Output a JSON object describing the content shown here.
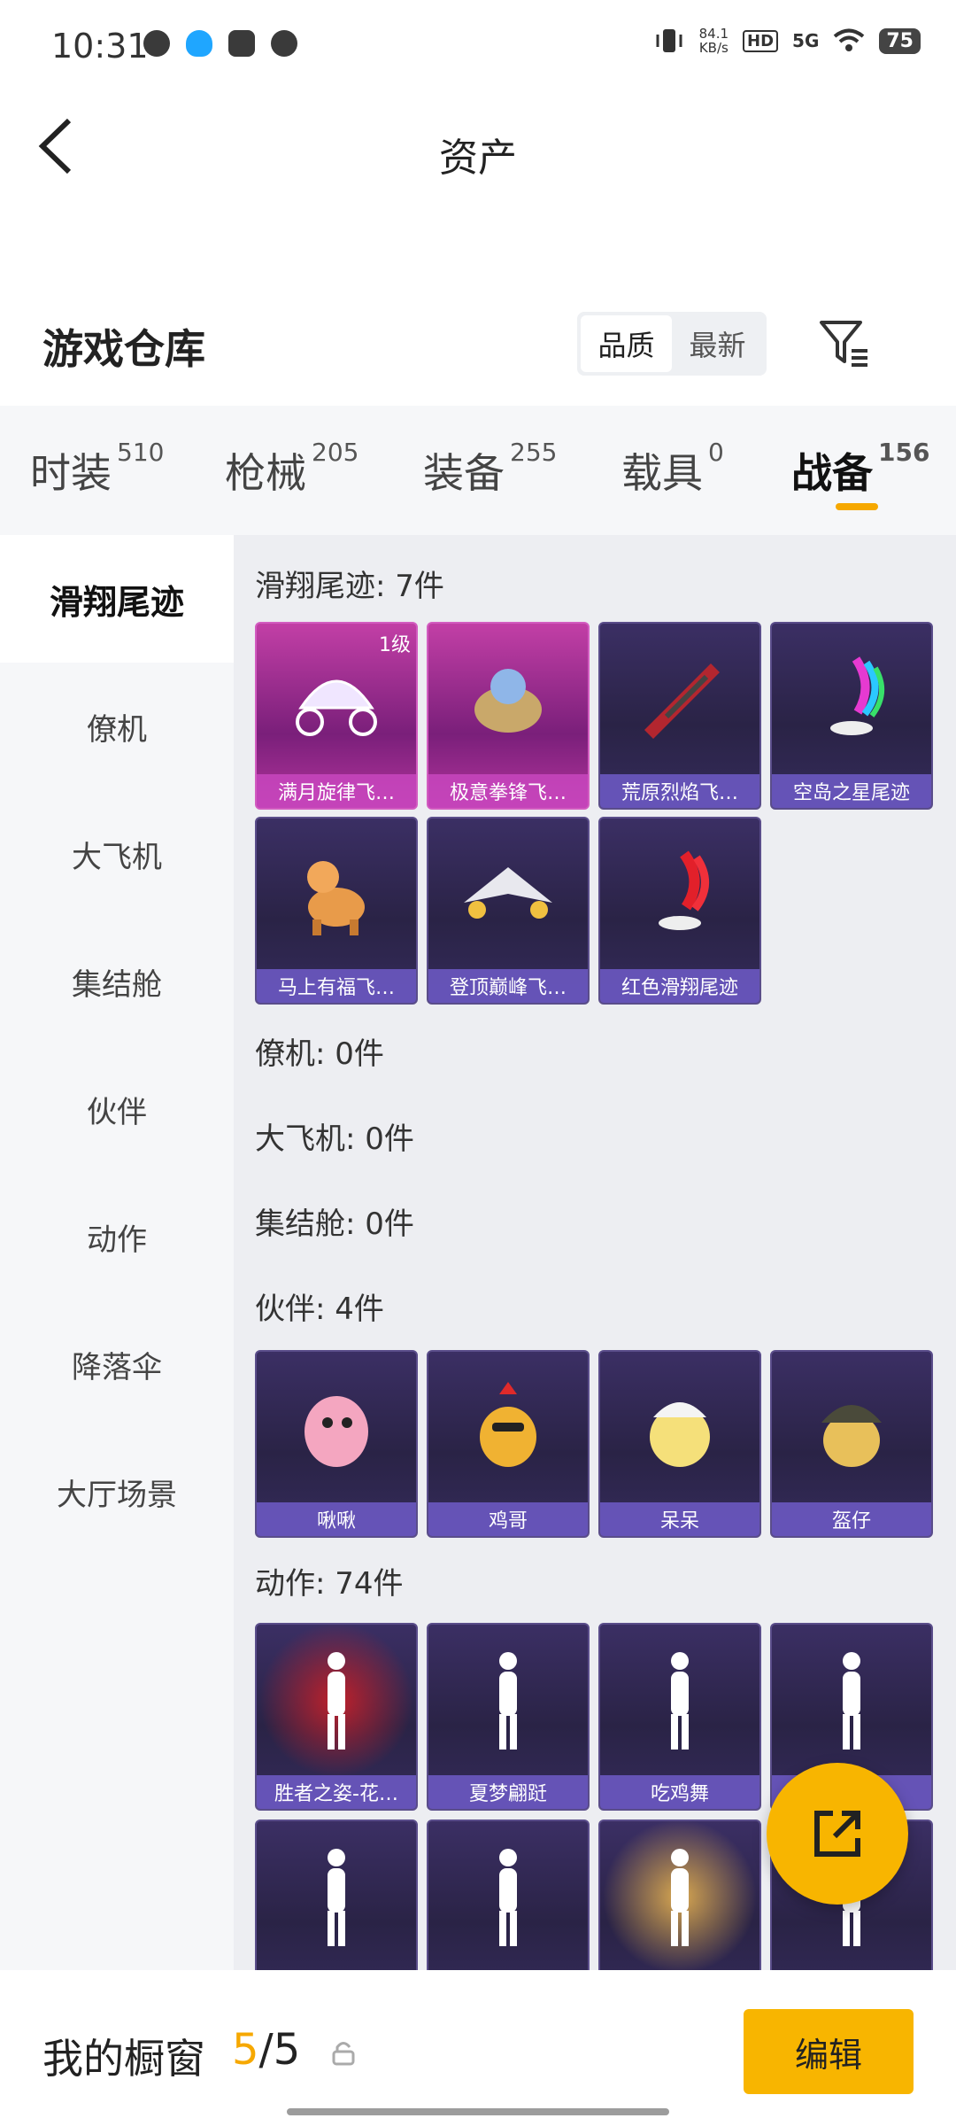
{
  "status_bar": {
    "time": "10:31",
    "speed_value": "84.1",
    "speed_unit": "KB/s",
    "hd": "HD",
    "network": "5G",
    "battery": "75",
    "icons": [
      "chat-bubble-icon",
      "qq-icon",
      "mail-icon",
      "link-icon",
      "vibrate-icon",
      "wifi-icon"
    ]
  },
  "header": {
    "title": "资产"
  },
  "warehouse": {
    "title": "游戏仓库",
    "sort_options": [
      "品质",
      "最新"
    ],
    "active_sort": "品质"
  },
  "tabs": [
    {
      "label": "时装",
      "count": "510"
    },
    {
      "label": "枪械",
      "count": "205"
    },
    {
      "label": "装备",
      "count": "255"
    },
    {
      "label": "载具",
      "count": "0"
    },
    {
      "label": "战备",
      "count": "156"
    }
  ],
  "active_tab": "战备",
  "sidebar": {
    "items": [
      "滑翔尾迹",
      "僚机",
      "大飞机",
      "集结舱",
      "伙伴",
      "动作",
      "降落伞",
      "大厅场景"
    ],
    "active": "滑翔尾迹"
  },
  "sections": {
    "glide_trail": {
      "title": "滑翔尾迹: 7件",
      "items": [
        {
          "label": "满月旋律飞…",
          "badge": "1级",
          "style": "pink",
          "icon": "carriage-icon"
        },
        {
          "label": "极意拳锋飞…",
          "style": "pink",
          "icon": "mascot-icon"
        },
        {
          "label": "荒原烈焰飞…",
          "style": "purple",
          "icon": "wing-icon"
        },
        {
          "label": "空岛之星尾迹",
          "style": "purple",
          "icon": "rainbow-trail-icon"
        },
        {
          "label": "马上有福飞…",
          "style": "purple",
          "icon": "horse-icon"
        },
        {
          "label": "登顶巅峰飞…",
          "style": "purple",
          "icon": "jet-icon"
        },
        {
          "label": "红色滑翔尾迹",
          "style": "purple",
          "icon": "red-trail-icon"
        }
      ]
    },
    "wingman": {
      "title": "僚机: 0件"
    },
    "big_plane": {
      "title": "大飞机: 0件"
    },
    "rally_pod": {
      "title": "集结舱: 0件"
    },
    "companion": {
      "title": "伙伴: 4件",
      "items": [
        {
          "label": "啾啾",
          "style": "purple",
          "icon": "pink-bird-icon"
        },
        {
          "label": "鸡哥",
          "style": "purple",
          "icon": "rooster-icon"
        },
        {
          "label": "呆呆",
          "style": "purple",
          "icon": "chick-icon"
        },
        {
          "label": "盔仔",
          "style": "purple",
          "icon": "helmet-chick-icon"
        }
      ]
    },
    "emote": {
      "title": "动作: 74件",
      "items": [
        {
          "label": "胜者之姿-花…",
          "style": "purple",
          "icon": "pose-icon"
        },
        {
          "label": "夏梦翩跹",
          "style": "purple",
          "icon": "dance-icon"
        },
        {
          "label": "吃鸡舞",
          "style": "purple",
          "icon": "dance-icon"
        },
        {
          "label": "",
          "style": "purple",
          "icon": "dance-icon"
        },
        {
          "label": "",
          "style": "purple",
          "icon": "dance-icon"
        },
        {
          "label": "",
          "style": "purple",
          "icon": "dance-icon"
        },
        {
          "label": "",
          "style": "purple",
          "icon": "angel-icon"
        },
        {
          "label": "",
          "style": "purple",
          "icon": "dance-icon"
        }
      ]
    }
  },
  "bottom": {
    "my_window_label": "我的橱窗",
    "current": "5",
    "separator": "/",
    "total": "5",
    "edit_label": "编辑"
  },
  "colors": {
    "accent": "#f6a800",
    "button": "#f8b500"
  }
}
